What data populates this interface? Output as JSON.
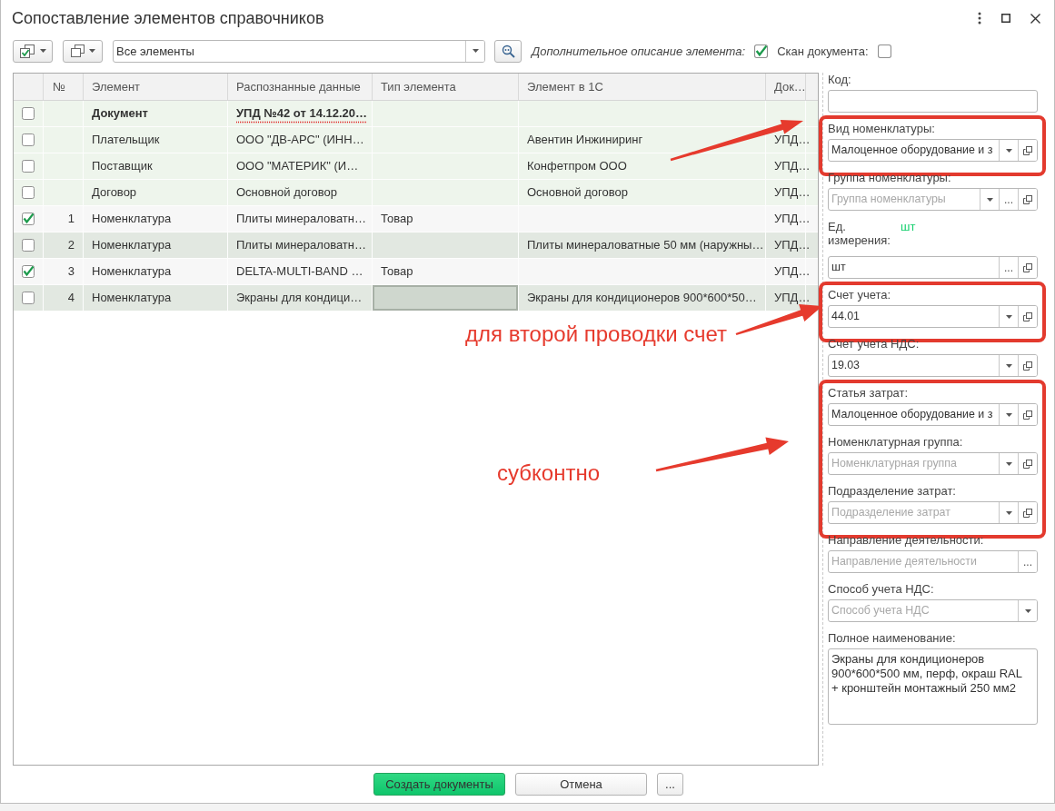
{
  "window": {
    "title": "Сопоставление элементов справочников"
  },
  "toolbar": {
    "filter": {
      "value": "Все элементы"
    },
    "options": [
      {
        "label": "Дополнительное описание элемента:",
        "italic": true,
        "checked": true
      },
      {
        "label": "Скан документа:",
        "italic": false,
        "checked": false
      }
    ]
  },
  "table": {
    "columns": [
      "№",
      "Элемент",
      "Распознанные данные",
      "Тип элемента",
      "Элемент в 1С",
      "Док…"
    ],
    "rows": [
      {
        "kind": "document",
        "checked": false,
        "selected": false,
        "element": "Документ",
        "recognized": "УПД №42 от 14.12.20…"
      },
      {
        "kind": "requisite",
        "checked": false,
        "selected": false,
        "element": "Плательщик",
        "recognized": "ООО \"ДВ-АРС\" (ИНН…",
        "in_1c": "Авентин Инжиниринг",
        "document": "УПД…"
      },
      {
        "kind": "requisite",
        "checked": false,
        "selected": false,
        "element": "Поставщик",
        "recognized": "ООО \"МАТЕРИК\" (И…",
        "in_1c": "Конфетпром ООО",
        "document": "УПД…"
      },
      {
        "kind": "requisite",
        "checked": false,
        "selected": false,
        "element": "Договор",
        "recognized": "Основной договор",
        "in_1c": "Основной договор",
        "document": "УПД…"
      },
      {
        "kind": "item",
        "checked": true,
        "selected": false,
        "number": "1",
        "element": "Номенклатура",
        "recognized": "Плиты минераловатн…",
        "type": "Товар",
        "document": "УПД…"
      },
      {
        "kind": "item",
        "checked": false,
        "selected": false,
        "number": "2",
        "element": "Номенклатура",
        "recognized": "Плиты минераловатн…",
        "in_1c": "Плиты минераловатные 50 мм (наружны…",
        "document": "УПД…"
      },
      {
        "kind": "item",
        "checked": true,
        "selected": false,
        "number": "3",
        "element": "Номенклатура",
        "recognized": "DELTA-MULTI-BAND …",
        "type": "Товар",
        "document": "УПД…"
      },
      {
        "kind": "item",
        "checked": false,
        "selected": true,
        "number": "4",
        "element": "Номенклатура",
        "recognized": "Экраны для кондици…",
        "in_1c": "Экраны для кондиционеров 900*600*50…",
        "document": "УПД…"
      }
    ]
  },
  "details": {
    "groups": [
      {
        "highlighted": false,
        "fields": [
          {
            "kind": "input",
            "label": "Код:"
          }
        ]
      },
      {
        "highlighted": true,
        "fields": [
          {
            "kind": "input",
            "label": "Вид номенклатуры:",
            "value": "Малоценное оборудование и з",
            "buttons": [
              {
                "kind": "dropdown"
              },
              {
                "kind": "open"
              }
            ]
          }
        ]
      },
      {
        "highlighted": false,
        "fields": [
          {
            "kind": "input",
            "label": "Группа номенклатуры:",
            "placeholder": "Группа номенклатуры",
            "buttons": [
              {
                "kind": "dropdown"
              },
              {
                "kind": "choose",
                "label": "..."
              },
              {
                "kind": "open"
              }
            ]
          },
          {
            "kind": "input",
            "label": "Ед. измерения:",
            "note": "шт",
            "value": "шт",
            "buttons": [
              {
                "kind": "choose",
                "label": "..."
              },
              {
                "kind": "open"
              }
            ]
          }
        ]
      },
      {
        "highlighted": true,
        "fields": [
          {
            "kind": "input",
            "label": "Счет учета:",
            "value": "44.01",
            "buttons": [
              {
                "kind": "dropdown"
              },
              {
                "kind": "open"
              }
            ]
          }
        ]
      },
      {
        "highlighted": false,
        "fields": [
          {
            "kind": "input",
            "label": "Счет учета НДС:",
            "value": "19.03",
            "buttons": [
              {
                "kind": "dropdown"
              },
              {
                "kind": "open"
              }
            ]
          }
        ]
      },
      {
        "highlighted": true,
        "fields": [
          {
            "kind": "input",
            "label": "Статья затрат:",
            "value": "Малоценное оборудование и з",
            "buttons": [
              {
                "kind": "dropdown"
              },
              {
                "kind": "open"
              }
            ]
          },
          {
            "kind": "input",
            "label": "Номенклатурная группа:",
            "placeholder": "Номенклатурная группа",
            "buttons": [
              {
                "kind": "dropdown"
              },
              {
                "kind": "open"
              }
            ]
          },
          {
            "kind": "input",
            "label": "Подразделение затрат:",
            "placeholder": "Подразделение затрат",
            "buttons": [
              {
                "kind": "dropdown"
              },
              {
                "kind": "open"
              }
            ]
          }
        ]
      },
      {
        "highlighted": false,
        "fields": [
          {
            "kind": "input",
            "label": "Направление деятельности:",
            "placeholder": "Направление деятельности",
            "buttons": [
              {
                "kind": "choose",
                "label": "..."
              }
            ]
          },
          {
            "kind": "input",
            "label": "Способ учета НДС:",
            "placeholder": "Способ учета НДС",
            "buttons": [
              {
                "kind": "dropdown"
              }
            ]
          },
          {
            "kind": "textarea",
            "label": "Полное наименование:",
            "value": "Экраны для кондиционеров\n900*600*500 мм, перф, окраш RAL\n+ кронштейн монтажный 250 мм2"
          }
        ]
      }
    ]
  },
  "annotations": [
    {
      "text": "для второй проводки счет"
    },
    {
      "text": "субконтно"
    }
  ],
  "footer": {
    "buttons": [
      {
        "kind": "primary",
        "label": "Создать документы"
      },
      {
        "kind": "normal",
        "label": "Отмена"
      },
      {
        "kind": "more",
        "label": "..."
      }
    ]
  }
}
